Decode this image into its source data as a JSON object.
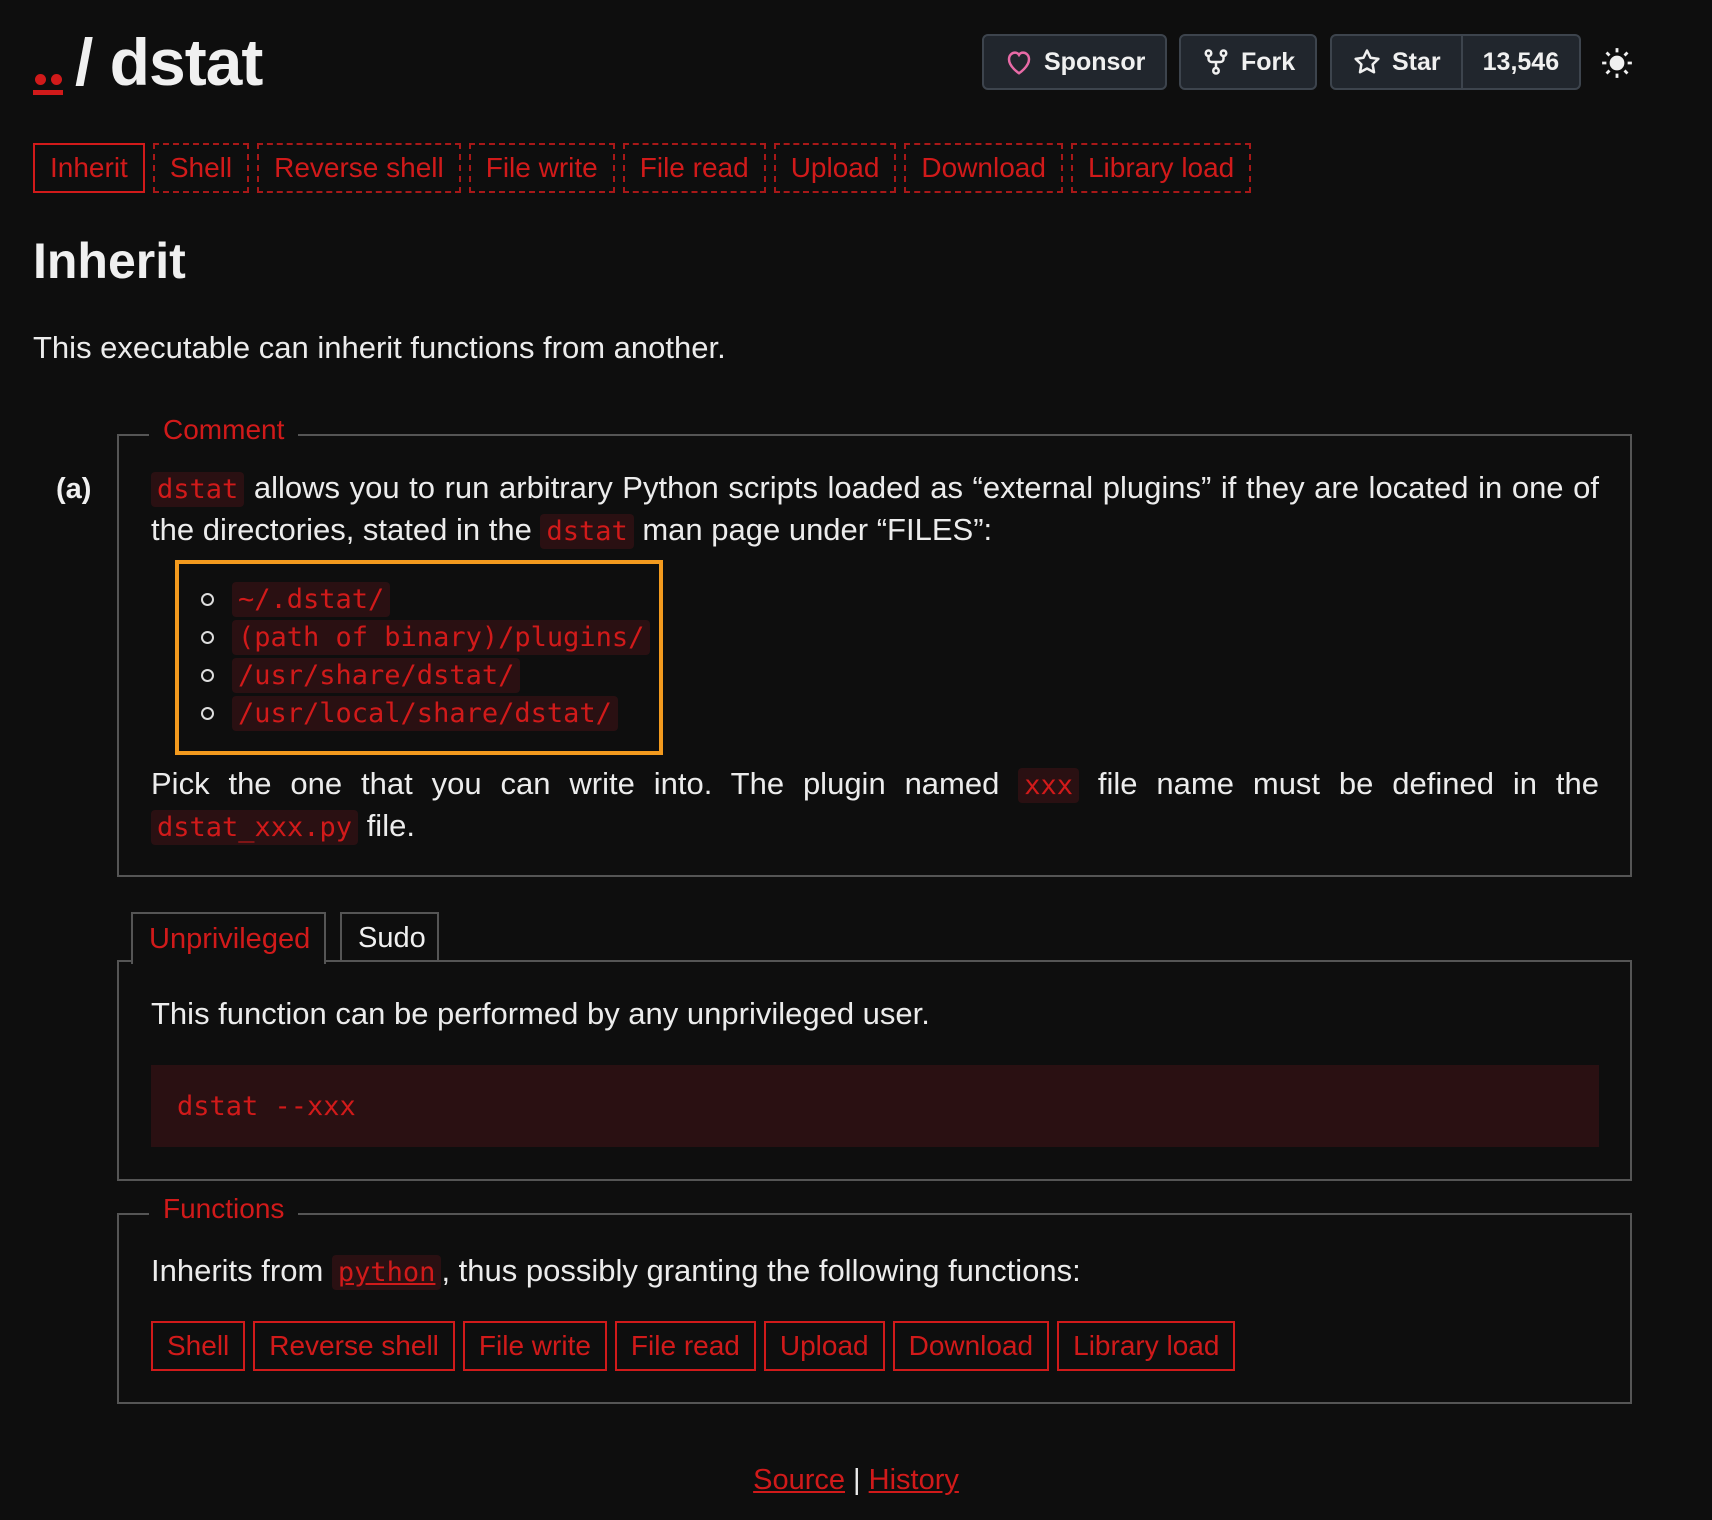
{
  "header": {
    "title": "/ dstat",
    "sponsor_label": "Sponsor",
    "fork_label": "Fork",
    "star_label": "Star",
    "star_count": "13,546"
  },
  "function_tabs": [
    "Inherit",
    "Shell",
    "Reverse shell",
    "File write",
    "File read",
    "Upload",
    "Download",
    "Library load"
  ],
  "section": {
    "title": "Inherit",
    "description": "This executable can inherit functions from another."
  },
  "comment": {
    "legend": "Comment",
    "item_label": "(a)",
    "p1_code1": "dstat",
    "p1_text1": " allows you to run arbitrary Python scripts loaded as “external plugins” if they are located in one of the directories, stated in the ",
    "p1_code2": "dstat",
    "p1_text2": " man page under “FILES”:",
    "directories": [
      "~/.dstat/",
      "(path of binary)/plugins/",
      "/usr/share/dstat/",
      "/usr/local/share/dstat/"
    ],
    "p2_text1": "Pick the one that you can write into. The plugin named ",
    "p2_code1": "xxx",
    "p2_text2": " file name must be defined in the ",
    "p2_code2": "dstat_xxx.py",
    "p2_text3": " file."
  },
  "privilege_tabs": {
    "unprivileged": "Unprivileged",
    "sudo": "Sudo"
  },
  "unprivileged_panel": {
    "text": "This function can be performed by any unprivileged user.",
    "code": "dstat --xxx"
  },
  "functions": {
    "legend": "Functions",
    "text1": "Inherits from ",
    "link": "python",
    "text2": ", thus possibly granting the following functions:",
    "items": [
      "Shell",
      "Reverse shell",
      "File write",
      "File read",
      "Upload",
      "Download",
      "Library load"
    ]
  },
  "footer": {
    "source": "Source",
    "separator": " | ",
    "history": "History"
  },
  "colors": {
    "accent": "#d11a1a",
    "highlight_box": "#f39a1e",
    "background": "#0e0e0e"
  }
}
